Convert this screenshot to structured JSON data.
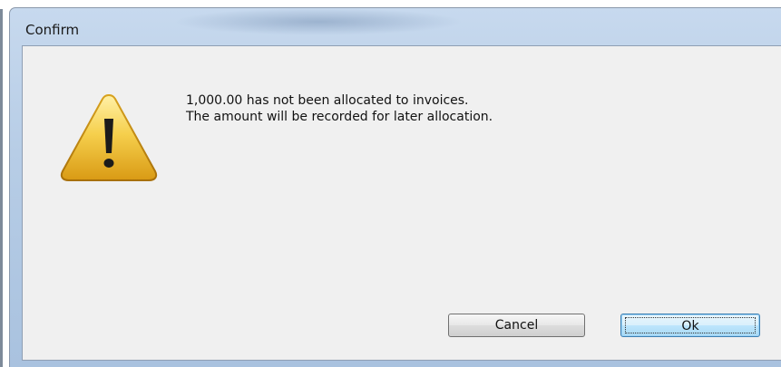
{
  "window": {
    "title": "Confirm"
  },
  "message": {
    "line1": "1,000.00 has not been allocated to invoices.",
    "line2": "The amount will be recorded for later allocation."
  },
  "icons": {
    "warning": "warning-icon"
  },
  "buttons": {
    "cancel_label": "Cancel",
    "ok_label": "Ok"
  },
  "colors": {
    "titlebar": "#b7cde6",
    "client_bg": "#f0f0f0",
    "warning_fill": "#f2c53d",
    "default_button_border": "#3c7fb1"
  }
}
